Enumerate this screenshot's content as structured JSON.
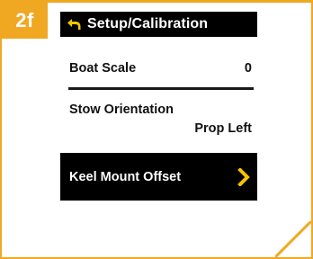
{
  "step": {
    "label": "2f"
  },
  "colors": {
    "accent": "#f0a823",
    "highlight_arrow": "#f5c400",
    "screen_bg": "#000000"
  },
  "screen": {
    "title": "Setup/Calibration",
    "title_icon": "back-arrow-icon",
    "items": [
      {
        "label": "Boat Scale",
        "value": "0"
      },
      {
        "label": "Stow Orientation",
        "value": "Prop Left"
      },
      {
        "label": "Keel Mount Offset",
        "icon": "chevron-right-icon",
        "selected": true
      }
    ]
  }
}
